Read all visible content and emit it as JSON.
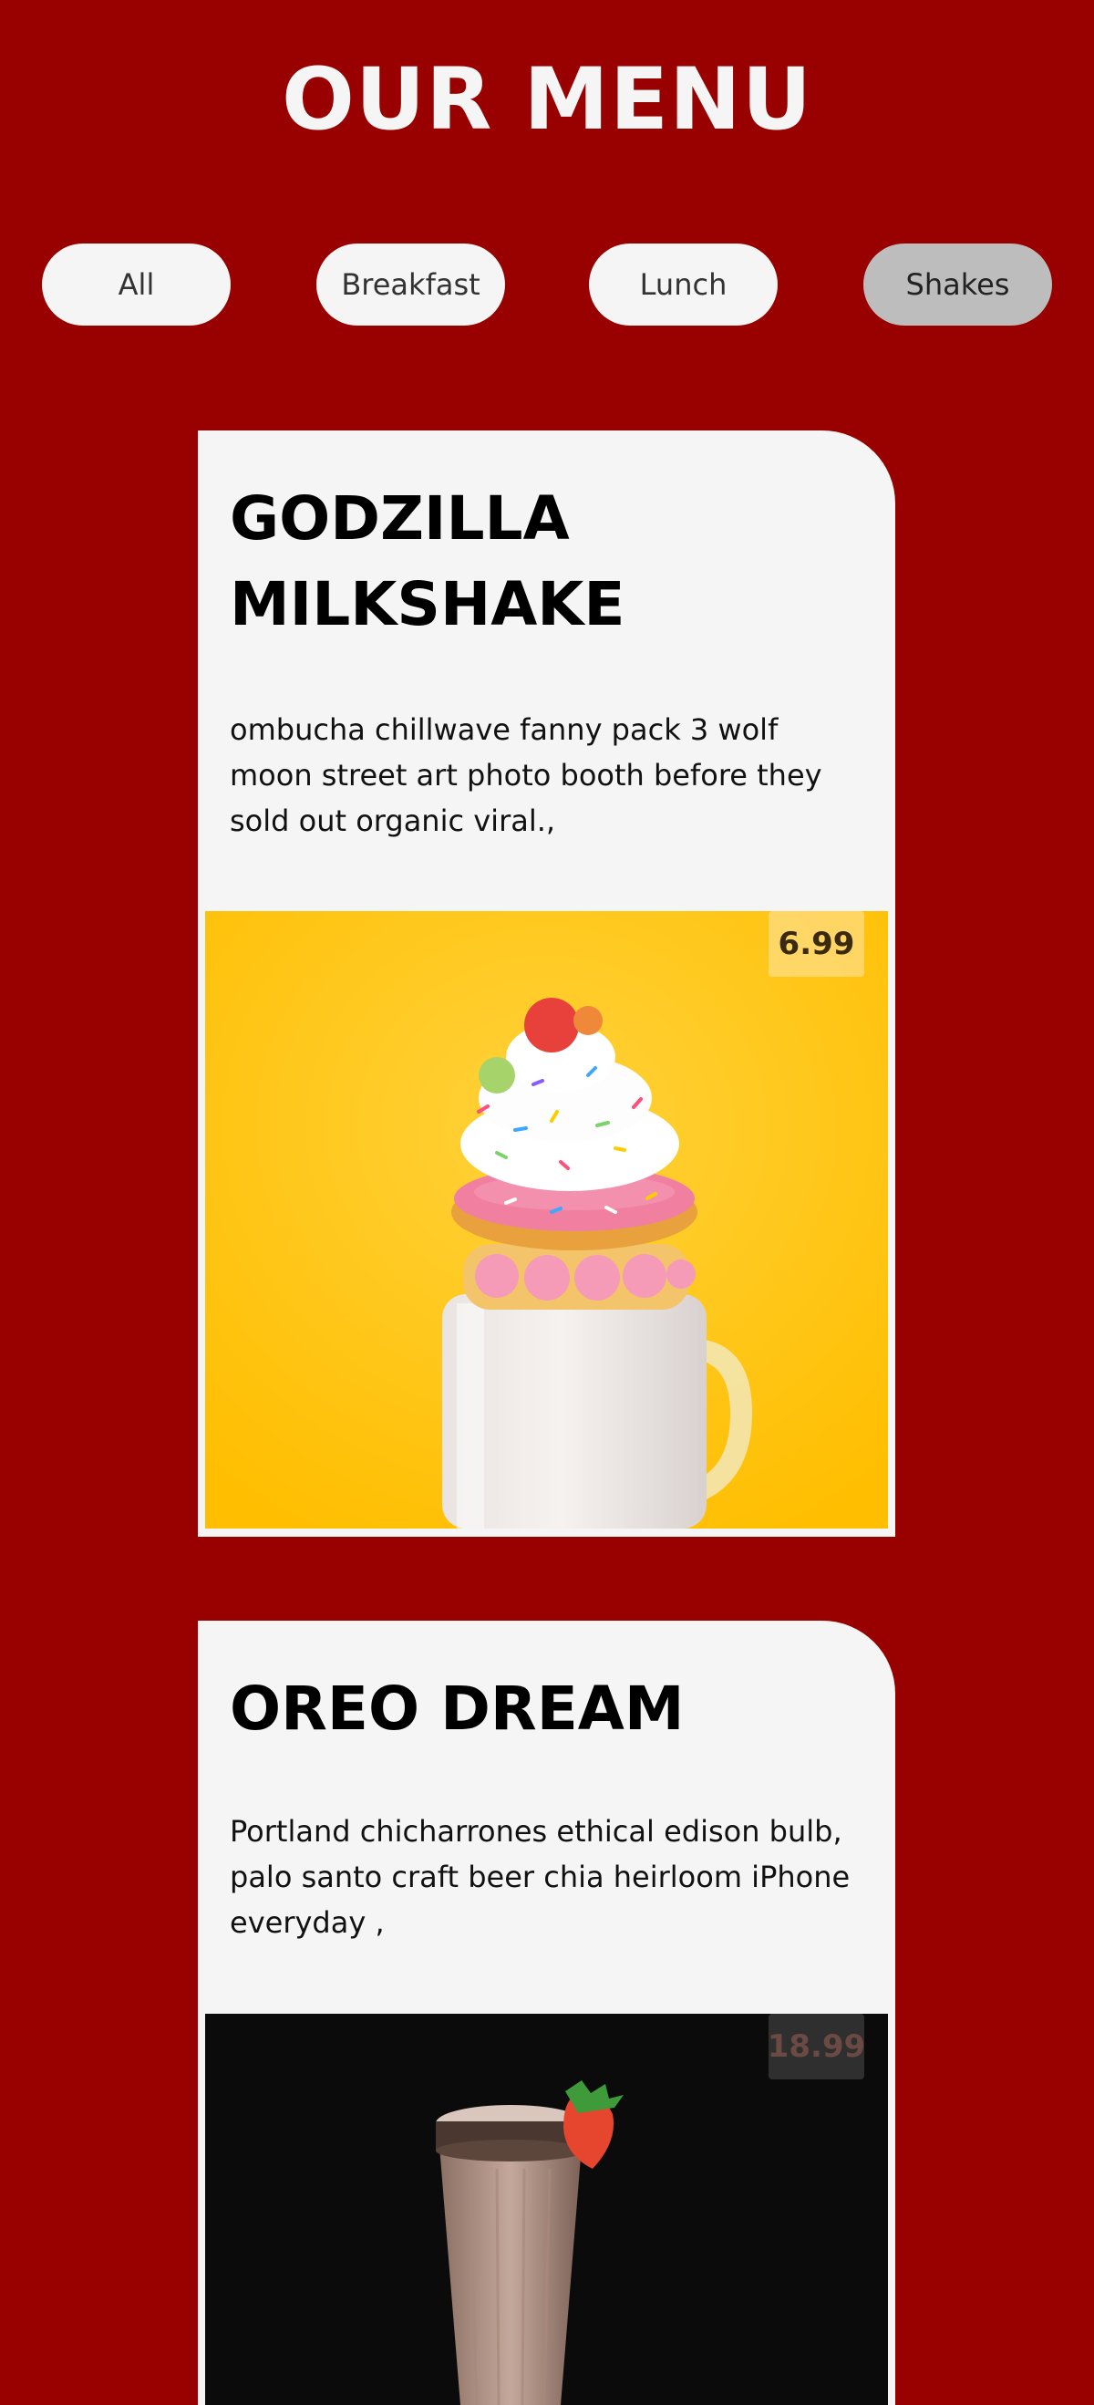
{
  "page": {
    "title": "OUR MENU",
    "background_color": "#990000"
  },
  "filters": [
    {
      "label": "All",
      "active": false
    },
    {
      "label": "Breakfast",
      "active": false
    },
    {
      "label": "Lunch",
      "active": false
    },
    {
      "label": "Shakes",
      "active": true
    }
  ],
  "menu_items": [
    {
      "title": "GODZILLA MILKSHAKE",
      "description": "ombucha chillwave fanny pack 3 wolf moon street art photo booth before they sold out organic viral.,",
      "price": "6.99",
      "image_icon": "milkshake-donut-photo"
    },
    {
      "title": "OREO DREAM",
      "description": "Portland chicharrones ethical edison bulb, palo santo craft beer chia heirloom iPhone everyday ,",
      "price": "18.99",
      "image_icon": "oreo-shake-photo"
    }
  ],
  "colors": {
    "accent": "#990000",
    "card": "#f5f5f5",
    "active_filter": "#bdbdbd"
  }
}
